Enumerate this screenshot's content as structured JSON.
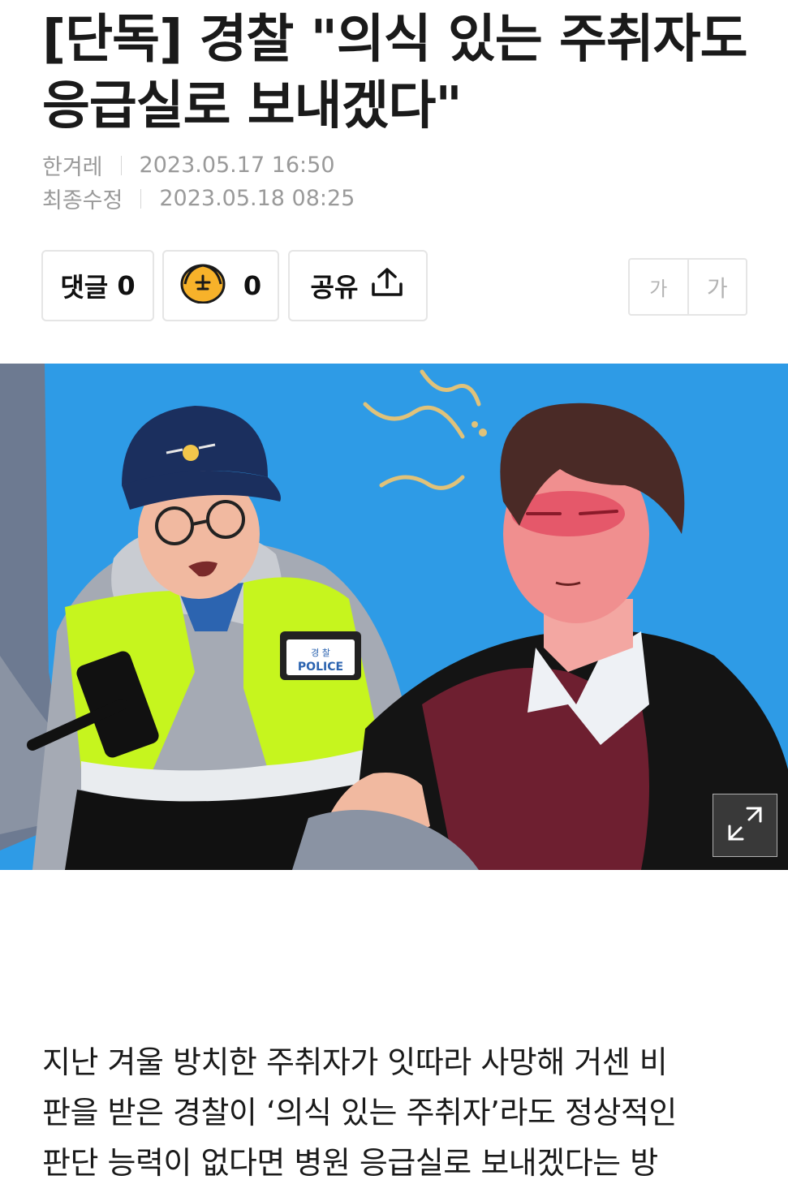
{
  "article": {
    "headline_line1": "[단독] 경찰 \"의식 있는 주취자도",
    "headline_line2": "응급실로 보내겠다\"",
    "source": "한겨레",
    "published": "2023.05.17 16:50",
    "modified_label": "최종수정",
    "modified": "2023.05.18 08:25",
    "body_line1": "지난 겨울 방치한 주취자가 잇따라 사망해 거센 비",
    "body_line2": "판을 받은 경찰이 ‘의식 있는 주취자’라도 정상적인",
    "body_line3": "판단 능력이 없다면 병원 응급실로 보내겠다는 방"
  },
  "actions": {
    "comment_label": "댓글",
    "comment_count": "0",
    "reaction_icon": "emoji-face-icon",
    "reaction_count": "0",
    "share_label": "공유",
    "share_icon": "share-upload-icon",
    "font_small": "가",
    "font_large": "가"
  },
  "hero_image": {
    "badge_text": "경 찰",
    "vest_label": "POLICE",
    "expand_icon": "expand-icon"
  },
  "colors": {
    "hero_bg": "#2e9be6",
    "vest": "#c6f51e",
    "cap": "#1b2f5e"
  }
}
